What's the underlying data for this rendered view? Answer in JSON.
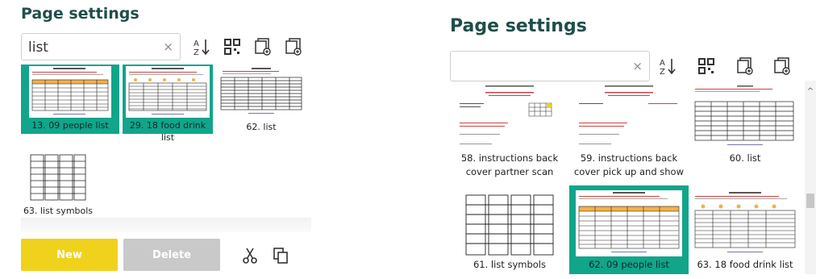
{
  "left": {
    "title": "Page settings",
    "search": {
      "value": "list",
      "clear_label": "×"
    },
    "tiles": [
      {
        "label": "13. 09 people list",
        "selected": true,
        "kind": "people"
      },
      {
        "label": "29. 18 food drink list",
        "selected": true,
        "kind": "food"
      },
      {
        "label": "62. list",
        "selected": false,
        "kind": "list"
      },
      {
        "label": "63. list symbols",
        "selected": false,
        "kind": "symbols"
      }
    ],
    "buttons": {
      "new": "New",
      "delete": "Delete"
    }
  },
  "right": {
    "title": "Page settings",
    "search": {
      "value": "",
      "clear_label": "×"
    },
    "tiles": [
      {
        "label": "58. instructions back cover partner scan",
        "selected": false,
        "kind": "instructions"
      },
      {
        "label": "59. instructions back cover pick up and show",
        "selected": false,
        "kind": "instructions2"
      },
      {
        "label": "60. list",
        "selected": false,
        "kind": "list"
      },
      {
        "label": "61. list symbols",
        "selected": false,
        "kind": "symbols"
      },
      {
        "label": "62. 09 people list",
        "selected": true,
        "kind": "people"
      },
      {
        "label": "63. 18 food drink list",
        "selected": false,
        "kind": "food"
      }
    ],
    "scroll_up_label": "^"
  },
  "icons": {
    "sort": "sort-az-icon",
    "qr": "qr-code-icon",
    "add_page": "add-page-icon",
    "add_page_alt": "add-page-copy-icon",
    "cut": "scissors-icon",
    "copy": "copy-icon"
  },
  "colors": {
    "brand": "#1f4e4a",
    "selected": "#11a58b",
    "new_button": "#f0d21c",
    "delete_button": "#c9c9c9"
  }
}
